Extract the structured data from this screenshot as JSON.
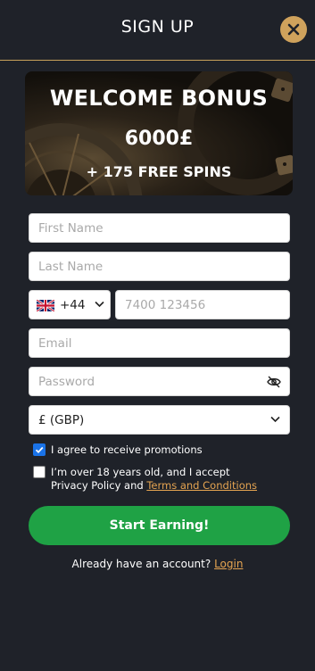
{
  "header": {
    "title": "SIGN UP"
  },
  "banner": {
    "headline": "WELCOME BONUS",
    "amount": "6000£",
    "spins": "+ 175 FREE SPINS"
  },
  "form": {
    "first_name": {
      "placeholder": "First Name",
      "value": ""
    },
    "last_name": {
      "placeholder": "Last Name",
      "value": ""
    },
    "phone": {
      "country_code": "+44",
      "country_flag": "uk-flag-icon",
      "placeholder": "7400 123456",
      "value": ""
    },
    "email": {
      "placeholder": "Email",
      "value": ""
    },
    "password": {
      "placeholder": "Password",
      "value": ""
    },
    "currency": {
      "selected": "£ (GBP)"
    },
    "promotions": {
      "label": "I agree to receive promotions",
      "checked": true
    },
    "terms": {
      "line1": "I’m over 18 years old, and I accept",
      "line2_prefix": "Privacy Policy and ",
      "link": "Terms and Conditions",
      "checked": false
    },
    "submit_label": "Start Earning!",
    "login_prompt": "Already have an account? ",
    "login_link": "Login"
  },
  "colors": {
    "background": "#1f2229",
    "accent_gold": "#cfa25c",
    "cta_green": "#1fa245",
    "link_orange": "#e5a451",
    "checkbox_blue": "#1a73e8"
  }
}
